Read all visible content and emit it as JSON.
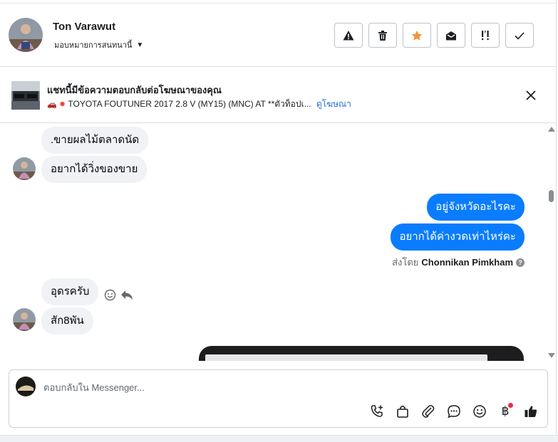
{
  "header": {
    "name": "Ton Varawut",
    "assign_label": "มอบหมายการสนทนานี้"
  },
  "ad": {
    "title": "แชทนี้มีข้อความตอบกลับต่อโฆษณาของคุณ",
    "description": "TOYOTA FOUTUNER 2017 2.8 V (MY15) (MNC) AT **ตัวท็อปเ...",
    "link": "ดูโฆษณา"
  },
  "messages": {
    "in1": ".ขายผลไม้ตลาดนัด",
    "in2": "อยากได้วิ่งของขาย",
    "out1": "อยู่จังหวัดอะไรคะ",
    "out2": "อยากได้ค่างวดเท่าไหร่คะ",
    "sent_by_prefix": "ส่งโดย",
    "sent_by_name": "Chonnikan Pimkham",
    "in3": "อุดรครับ",
    "in4": "สัก8พัน"
  },
  "composer": {
    "placeholder": "ตอบกลับใน Messenger...",
    "baht_symbol": "฿"
  },
  "colors": {
    "accent": "#0a7cff",
    "star": "#f7923b",
    "link": "#216fdb",
    "notification": "#f02849"
  }
}
